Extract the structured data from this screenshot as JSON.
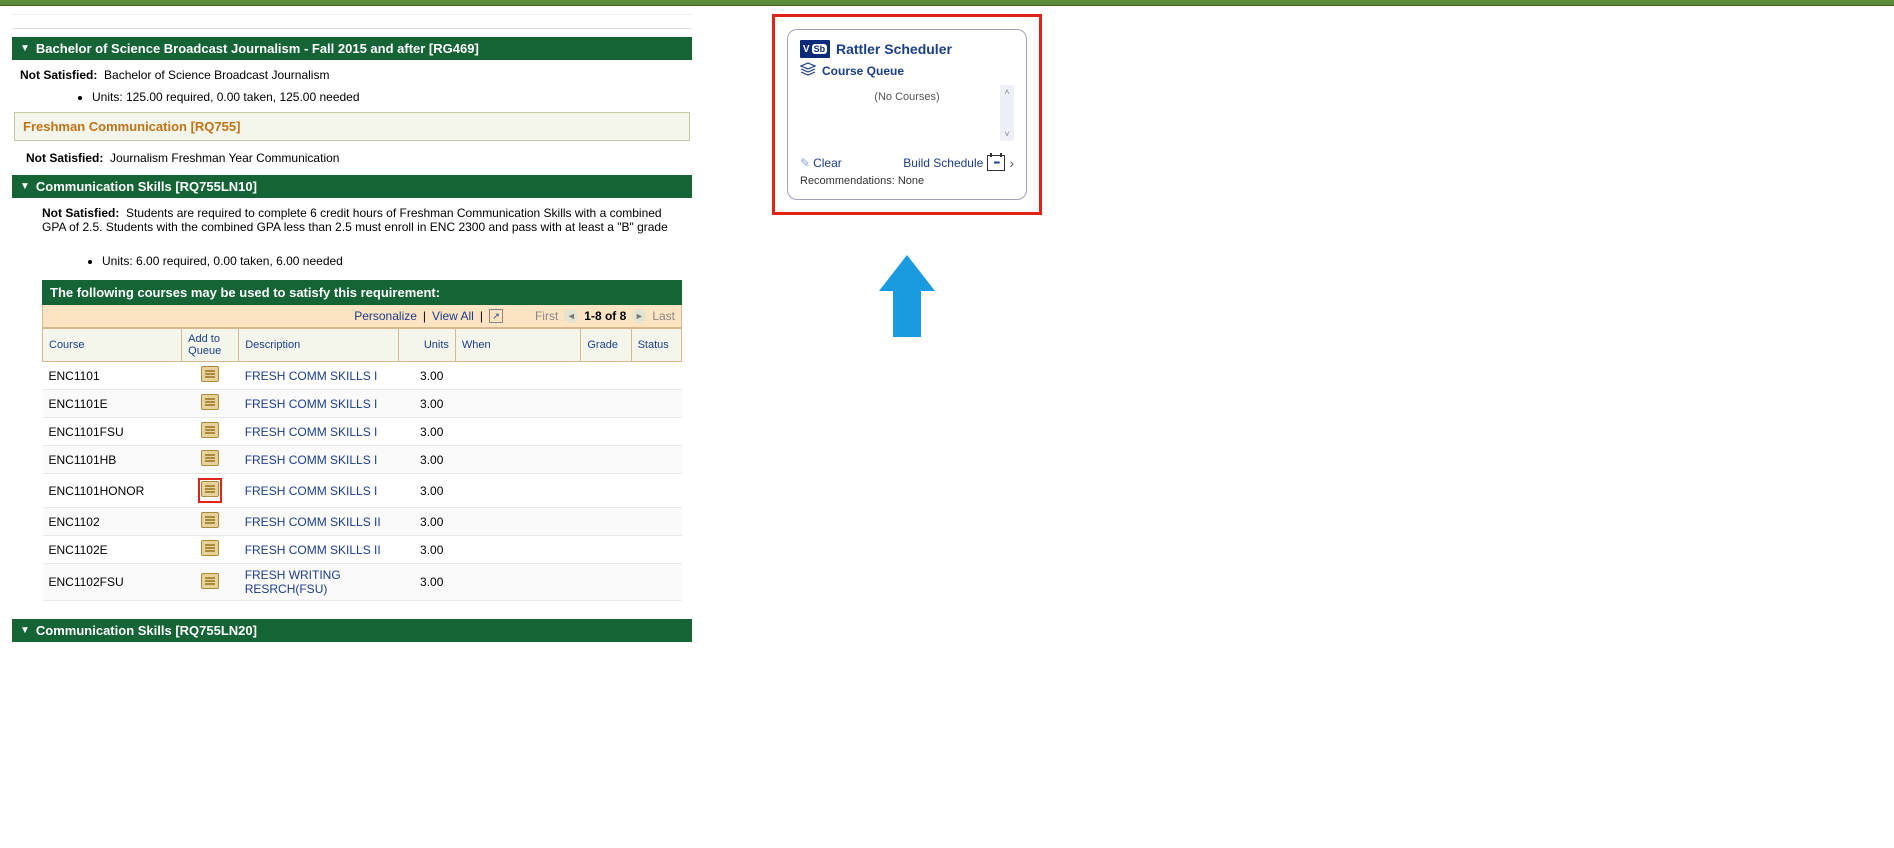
{
  "program": {
    "header": "Bachelor of Science Broadcast Journalism - Fall 2015 and after [RG469]",
    "not_satisfied_label": "Not Satisfied:",
    "not_satisfied_text": "Bachelor of Science Broadcast Journalism",
    "units_line": "Units: 125.00 required, 0.00 taken, 125.00 needed"
  },
  "sub_requirement": {
    "title": "Freshman Communication [RQ755]",
    "not_satisfied_label": "Not Satisfied:",
    "not_satisfied_text": "Journalism Freshman Year Communication"
  },
  "comm_skills_1": {
    "header": "Communication Skills [RQ755LN10]",
    "not_satisfied_label": "Not Satisfied:",
    "not_satisfied_text": "Students are required to complete 6 credit hours of Freshman Communication Skills with a combined GPA of 2.5. Students with the combined GPA less than 2.5 must enroll in ENC 2300 and pass with at least a \"B\" grade",
    "units_line": "Units: 6.00 required, 0.00 taken, 6.00 needed"
  },
  "course_table": {
    "header": "The following courses may be used to satisfy this requirement:",
    "controls": {
      "personalize": "Personalize",
      "view_all": "View All",
      "first": "First",
      "range": "1-8 of 8",
      "last": "Last"
    },
    "columns": {
      "course": "Course",
      "add_to_queue": "Add to Queue",
      "description": "Description",
      "units": "Units",
      "when": "When",
      "grade": "Grade",
      "status": "Status"
    },
    "rows": [
      {
        "course": "ENC1101",
        "desc": "FRESH COMM SKILLS I",
        "units": "3.00",
        "highlight": false
      },
      {
        "course": "ENC1101E",
        "desc": "FRESH COMM SKILLS I",
        "units": "3.00",
        "highlight": false
      },
      {
        "course": "ENC1101FSU",
        "desc": "FRESH COMM SKILLS I",
        "units": "3.00",
        "highlight": false
      },
      {
        "course": "ENC1101HB",
        "desc": "FRESH COMM SKILLS I",
        "units": "3.00",
        "highlight": false
      },
      {
        "course": "ENC1101HONOR",
        "desc": "FRESH COMM SKILLS I",
        "units": "3.00",
        "highlight": true
      },
      {
        "course": "ENC1102",
        "desc": "FRESH COMM SKILLS II",
        "units": "3.00",
        "highlight": false
      },
      {
        "course": "ENC1102E",
        "desc": "FRESH COMM SKILLS II",
        "units": "3.00",
        "highlight": false
      },
      {
        "course": "ENC1102FSU",
        "desc": "FRESH WRITING RESRCH(FSU)",
        "units": "3.00",
        "highlight": false
      }
    ]
  },
  "comm_skills_2": {
    "header": "Communication Skills [RQ755LN20]"
  },
  "scheduler": {
    "logo_v": "V",
    "logo_sb": "Sb",
    "title": "Rattler Scheduler",
    "course_queue": "Course Queue",
    "no_courses": "(No Courses)",
    "clear": "Clear",
    "build_schedule": "Build Schedule",
    "recommendations_label": "Recommendations:",
    "recommendations_value": "None"
  }
}
